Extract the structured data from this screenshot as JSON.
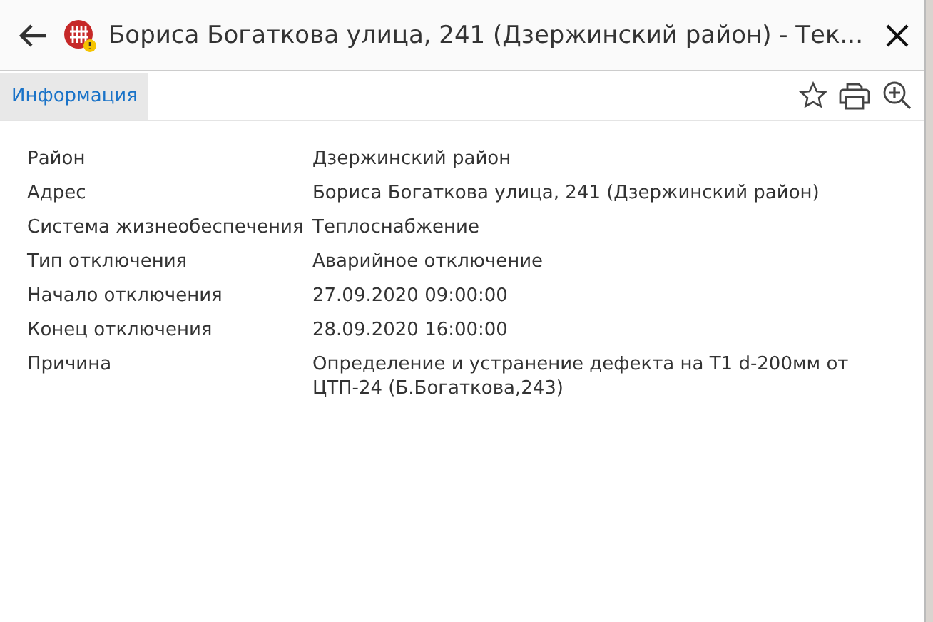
{
  "window": {
    "title": "Бориса Богаткова улица, 241 (Дзержинский район) - Тек..."
  },
  "tabs": [
    {
      "label": "Информация",
      "selected": true
    }
  ],
  "info": {
    "rows": [
      {
        "label": "Район",
        "value": "Дзержинский район"
      },
      {
        "label": "Адрес",
        "value": "Бориса Богаткова улица, 241 (Дзержинский район)"
      },
      {
        "label": "Система жизнеобеспечения",
        "value": "Теплоснабжение"
      },
      {
        "label": "Тип отключения",
        "value": "Аварийное отключение"
      },
      {
        "label": "Начало отключения",
        "value": "27.09.2020 09:00:00"
      },
      {
        "label": "Конец отключения",
        "value": "28.09.2020 16:00:00"
      },
      {
        "label": "Причина",
        "value": "Определение и устранение дефекта на Т1 d-200мм от ЦТП-24 (Б.Богаткова,243)"
      }
    ]
  }
}
